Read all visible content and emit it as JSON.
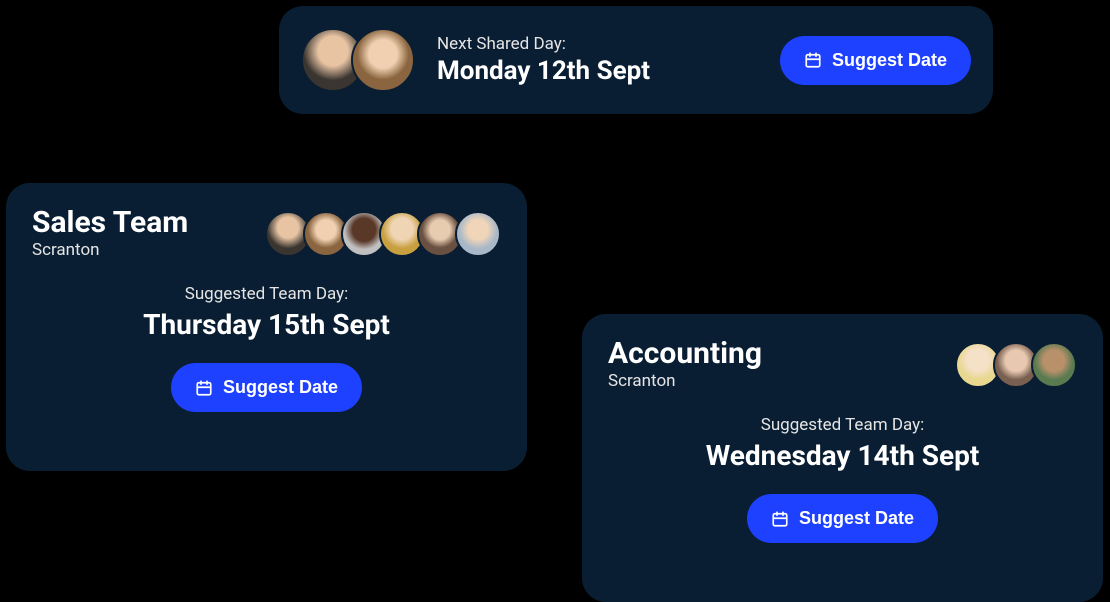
{
  "shared": {
    "label": "Next Shared Day:",
    "date": "Monday 12th Sept",
    "button": "Suggest Date",
    "avatars": [
      "person-1",
      "person-2"
    ]
  },
  "cards": [
    {
      "team": "Sales Team",
      "location": "Scranton",
      "label": "Suggested Team Day:",
      "date": "Thursday 15th Sept",
      "button": "Suggest Date",
      "avatars": [
        "person-1",
        "person-2",
        "person-3",
        "person-4",
        "person-5",
        "person-6"
      ]
    },
    {
      "team": "Accounting",
      "location": "Scranton",
      "label": "Suggested Team Day:",
      "date": "Wednesday 14th Sept",
      "button": "Suggest Date",
      "avatars": [
        "person-7",
        "person-8",
        "person-9"
      ]
    }
  ]
}
